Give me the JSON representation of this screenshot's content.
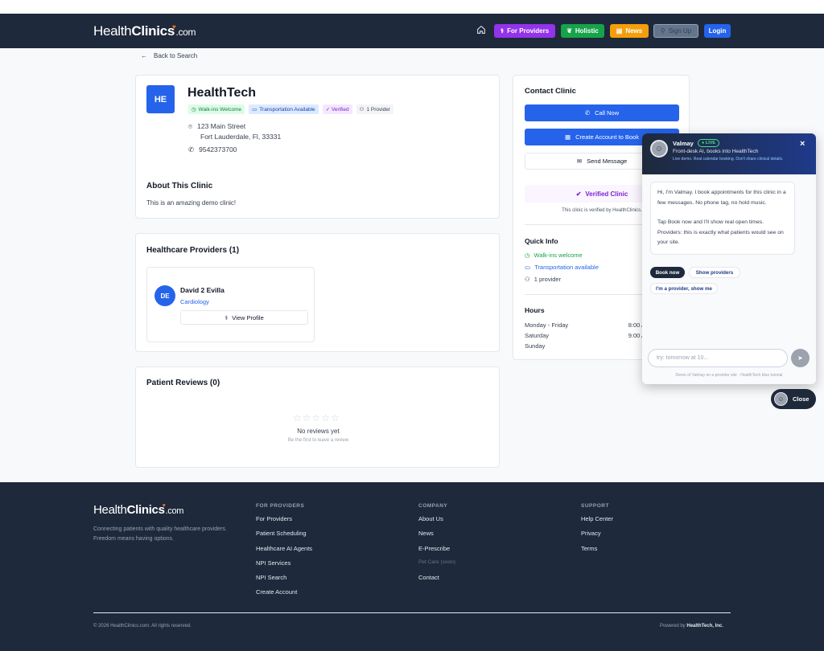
{
  "header": {
    "logo_a": "Health",
    "logo_b": "Clinics",
    "logo_c": ".com",
    "nav": {
      "for_providers": "For Providers",
      "holistic": "Holistic",
      "news": "News",
      "sign_up": "Sign Up",
      "login": "Login"
    }
  },
  "back_link": "Back to Search",
  "clinic": {
    "initials": "HE",
    "name": "HealthTech",
    "tags": [
      "Walk-ins Welcome",
      "Transportation Available",
      "✓ Verified",
      "1 Provider"
    ],
    "address_line1": "123 Main Street",
    "address_line2": "Fort Lauderdale, Fl, 33331",
    "phone": "9542373700",
    "about_title": "About This Clinic",
    "about_text": "This is an amazing demo clinic!"
  },
  "providers": {
    "title": "Healthcare Providers (1)",
    "items": [
      {
        "initials": "DE",
        "name": "David 2 Evilla",
        "specialty": "Cardiology",
        "button": "View Profile"
      }
    ]
  },
  "reviews": {
    "title": "Patient Reviews (0)",
    "empty": "No reviews yet",
    "hint": "Be the first to leave a review"
  },
  "contact": {
    "title": "Contact Clinic",
    "call": "Call Now",
    "create": "Create Account to Book",
    "message": "Send Message",
    "verified": "Verified Clinic",
    "verified_note": "This clinic is verified by HealthClinics.",
    "quick_info_title": "Quick Info",
    "quick_info": [
      "Walk-ins welcome",
      "Transportation available",
      "1 provider"
    ],
    "hours_title": "Hours",
    "hours": [
      {
        "day": "Monday - Friday",
        "time": "8:00 A"
      },
      {
        "day": "Saturday",
        "time": "9:00 A"
      },
      {
        "day": "Sunday",
        "time": ""
      }
    ]
  },
  "chat": {
    "name": "Valmay",
    "live": "LIVE",
    "subtitle": "Front-desk AI, books into HealthTech",
    "note": "Live demo. Real calendar booking. Don't share clinical details.",
    "message_p1": "Hi, I'm Valmay. I book appointments for this clinic in a few messages. No phone tag, no hold music.",
    "message_p2": "Tap Book now and I'll show real open times. Providers: this is exactly what patients would see on your site.",
    "reply_book": "Book now",
    "reply_show": "Show providers",
    "reply_im": "I'm a provider, show me",
    "placeholder": "try: tomorrow at 10...",
    "footer": "Demo of Valmay on a provider site · HealthTech blue tutorial",
    "close_label": "Close"
  },
  "footer": {
    "logo_a": "Health",
    "logo_b": "Clinics",
    "logo_c": ".com",
    "tagline": "Connecting patients with quality healthcare providers. Freedom means having options.",
    "col1_title": "FOR PROVIDERS",
    "col1": [
      "For Providers",
      "Patient Scheduling",
      "Healthcare AI Agents",
      "NPI Services",
      "NPI Search",
      "Create Account"
    ],
    "col2_title": "COMPANY",
    "col2": [
      "About Us",
      "News",
      "E-Prescribe",
      "Pet Care (soon)",
      "Contact"
    ],
    "col3_title": "SUPPORT",
    "col3": [
      "Help Center",
      "Privacy",
      "Terms"
    ],
    "copyright": "© 2026 HealthClinics.com. All rights reserved.",
    "powered": "Powered by",
    "powered_by": "HealthTech, Inc."
  }
}
